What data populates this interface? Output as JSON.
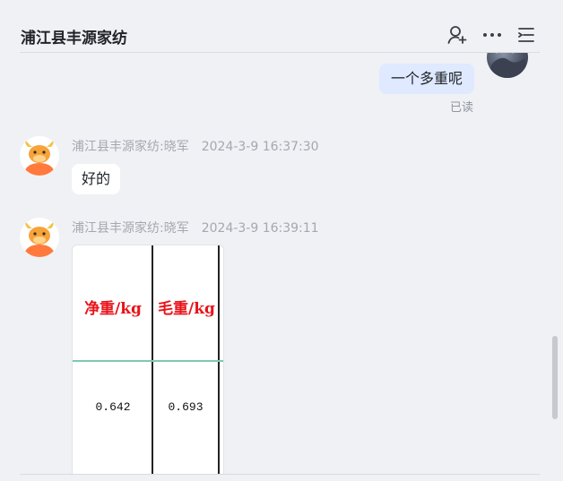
{
  "header": {
    "title": "浦江县丰源家纺",
    "icons": [
      "add-member-icon",
      "more-icon",
      "list-menu-icon"
    ]
  },
  "messages": {
    "outgoing": {
      "text": "一个多重呢",
      "status": "已读"
    },
    "incoming_1": {
      "sender": "浦江县丰源家纺:晓军",
      "time": "2024-3-9 16:37:30",
      "text": "好的"
    },
    "incoming_2": {
      "sender": "浦江县丰源家纺:晓军",
      "time": "2024-3-9 16:39:11",
      "image": {
        "headers": [
          "净重/kg",
          "毛重/kg"
        ],
        "values": [
          "0.642",
          "0.693"
        ]
      }
    }
  },
  "colors": {
    "background": "#f0f1f5",
    "outgoing_bubble": "#dfe9ff",
    "incoming_bubble": "#ffffff",
    "meta_text": "#a3a8b0",
    "image_header_red": "#e8141a"
  }
}
